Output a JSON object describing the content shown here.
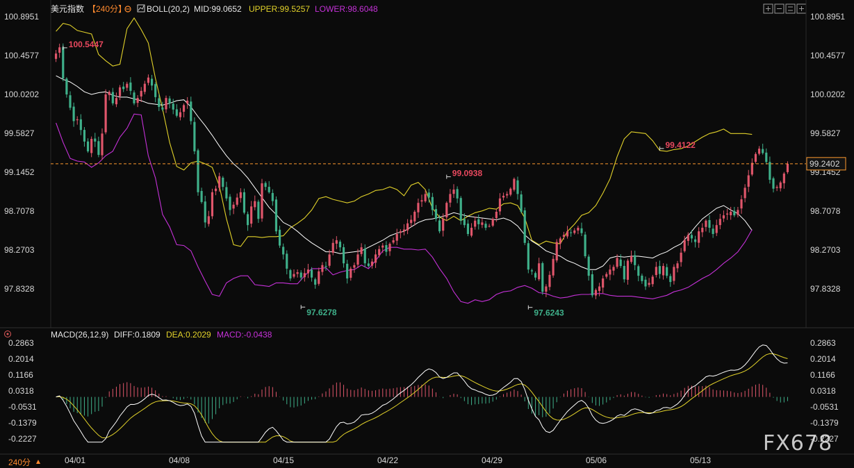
{
  "header": {
    "symbol": "美元指数",
    "period": "【240分】",
    "boll_label": "BOLL(20,2)",
    "mid_label": "MID:99.0652",
    "upper_label": "UPPER:99.5257",
    "lower_label": "LOWER:98.6048"
  },
  "macd_header": {
    "label": "MACD(26,12,9)",
    "diff_label": "DIFF:0.1809",
    "dea_label": "DEA:0.2029",
    "macd_label": "MACD:-0.0438"
  },
  "footer": {
    "period_button": "240分"
  },
  "watermark": "FX678",
  "colors": {
    "background": "#0b0b0b",
    "up": "#e0566b",
    "down": "#3fb08a",
    "boll_mid": "#ffffff",
    "boll_upper": "#e2d22a",
    "boll_lower": "#c531d8",
    "dea": "#e2d22a",
    "diff": "#ffffff",
    "current_price": "#ff9a2e",
    "high_label": "#e8485e",
    "low_label": "#3fb08a"
  },
  "icons": [
    "plus-icon",
    "minus-icon",
    "crosshair-icon",
    "layout-icon",
    "maximize-icon"
  ],
  "chart_data": [
    {
      "type": "candlestick",
      "title": "美元指数",
      "y_ticks": [
        "100.8951",
        "100.4577",
        "100.0202",
        "99.5827",
        "99.1452",
        "98.7078",
        "98.2703",
        "97.8328"
      ],
      "ylim": [
        97.75,
        100.9
      ],
      "x_ticks": [
        "04/01",
        "04/08",
        "04/15",
        "04/22",
        "04/29",
        "05/06",
        "05/13"
      ],
      "current_price": 99.2402,
      "current_price_label": "99.2402",
      "annotations": [
        {
          "label": "100.5447",
          "value": 100.5447,
          "kind": "high",
          "index": 2
        },
        {
          "label": "97.6278",
          "value": 97.6278,
          "kind": "low",
          "index": 69
        },
        {
          "label": "99.0938",
          "value": 99.0938,
          "kind": "high",
          "index": 110
        },
        {
          "label": "97.6243",
          "value": 97.6243,
          "kind": "low",
          "index": 133
        },
        {
          "label": "99.4122",
          "value": 99.4122,
          "kind": "high",
          "index": 170
        }
      ],
      "close": [
        100.48,
        100.55,
        100.2,
        100.02,
        99.87,
        99.72,
        99.74,
        99.62,
        99.49,
        99.38,
        99.52,
        99.49,
        99.34,
        99.58,
        100.02,
        100.05,
        99.92,
        99.98,
        100.1,
        100.08,
        100.14,
        100.06,
        99.92,
        99.98,
        100.06,
        100.14,
        100.21,
        100.12,
        99.99,
        99.88,
        99.85,
        99.98,
        99.92,
        99.85,
        99.78,
        99.82,
        99.9,
        99.95,
        99.72,
        99.38,
        98.92,
        98.81,
        98.58,
        98.65,
        98.92,
        98.96,
        99.1,
        98.98,
        98.85,
        98.72,
        98.78,
        98.86,
        98.92,
        98.69,
        98.55,
        98.76,
        98.82,
        98.62,
        99.02,
        98.98,
        98.92,
        98.82,
        98.48,
        98.32,
        98.22,
        98.06,
        97.95,
        98.0,
        98.02,
        97.96,
        98.01,
        98.05,
        97.96,
        97.88,
        98.03,
        98.1,
        98.08,
        98.22,
        98.35,
        98.38,
        98.3,
        98.12,
        97.95,
        98.06,
        98.1,
        98.22,
        98.3,
        98.12,
        98.09,
        98.14,
        98.22,
        98.28,
        98.32,
        98.25,
        98.34,
        98.38,
        98.45,
        98.48,
        98.5,
        98.57,
        98.61,
        98.7,
        98.8,
        98.83,
        98.9,
        98.86,
        98.72,
        98.62,
        98.48,
        98.62,
        98.8,
        98.9,
        98.95,
        98.85,
        98.6,
        98.55,
        98.45,
        98.52,
        98.6,
        98.56,
        98.58,
        98.52,
        98.54,
        98.62,
        98.7,
        98.85,
        98.88,
        98.9,
        98.96,
        99.07,
        98.9,
        98.7,
        98.35,
        98.05,
        98.03,
        97.96,
        98.12,
        97.8,
        97.86,
        97.99,
        98.17,
        98.36,
        98.4,
        98.44,
        98.48,
        98.46,
        98.49,
        98.52,
        98.46,
        98.2,
        97.98,
        97.76,
        97.82,
        97.86,
        97.95,
        98.0,
        98.05,
        98.08,
        98.18,
        98.09,
        97.94,
        98.15,
        98.2,
        98.1,
        97.98,
        97.92,
        97.86,
        97.9,
        97.97,
        98.08,
        98.0,
        98.09,
        97.98,
        97.91,
        98.08,
        98.12,
        98.24,
        98.38,
        98.44,
        98.4,
        98.36,
        98.48,
        98.52,
        98.6,
        98.52,
        98.45,
        98.55,
        98.62,
        98.66,
        98.68,
        98.7,
        98.66,
        98.72,
        98.84,
        98.97,
        99.11,
        99.25,
        99.35,
        99.41,
        99.36,
        99.26,
        99.06,
        98.96,
        98.98,
        99.03,
        99.13,
        99.24
      ],
      "boll_mid": [
        100.23,
        100.19,
        100.16,
        100.11,
        100.05,
        100.02,
        100.04,
        100.05,
        100.01,
        99.99,
        99.99,
        99.97,
        99.95,
        99.92,
        99.91,
        99.9,
        99.92,
        99.95,
        99.96,
        99.88,
        99.77,
        99.67,
        99.56,
        99.44,
        99.33,
        99.24,
        99.17,
        99.08,
        98.97,
        98.86,
        98.75,
        98.67,
        98.58,
        98.54,
        98.48,
        98.41,
        98.35,
        98.3,
        98.25,
        98.25,
        98.23,
        98.24,
        98.25,
        98.26,
        98.3,
        98.34,
        98.38,
        98.43,
        98.46,
        98.48,
        98.53,
        98.58,
        98.61,
        98.62,
        98.64,
        98.66,
        98.69,
        98.67,
        98.65,
        98.64,
        98.63,
        98.62,
        98.61,
        98.63,
        98.6,
        98.54,
        98.44,
        98.37,
        98.32,
        98.26,
        98.23,
        98.2,
        98.15,
        98.12,
        98.08,
        98.05,
        98.05,
        98.09,
        98.18,
        98.2,
        98.19,
        98.2,
        98.2,
        98.19,
        98.18,
        98.22,
        98.25,
        98.3,
        98.34,
        98.43,
        98.53,
        98.62,
        98.68,
        98.74,
        98.77,
        98.72,
        98.68,
        98.6,
        98.49
      ],
      "boll_upper": [
        100.73,
        100.82,
        100.8,
        100.74,
        100.72,
        100.7,
        100.47,
        100.4,
        100.34,
        100.36,
        100.76,
        100.88,
        100.75,
        100.6,
        100.2,
        99.86,
        99.48,
        99.21,
        99.17,
        99.25,
        99.27,
        99.24,
        99.2,
        98.99,
        98.62,
        98.33,
        98.31,
        98.42,
        98.42,
        98.41,
        98.42,
        98.42,
        98.43,
        98.52,
        98.57,
        98.63,
        98.72,
        98.85,
        98.87,
        98.84,
        98.82,
        98.8,
        98.82,
        98.87,
        98.9,
        98.94,
        98.95,
        98.98,
        98.95,
        98.88,
        99.0,
        99.03,
        98.95,
        98.74,
        98.64,
        98.6,
        98.65,
        98.6,
        98.65,
        98.69,
        98.71,
        98.74,
        98.73,
        98.79,
        98.8,
        98.77,
        98.63,
        98.38,
        98.33,
        98.37,
        98.35,
        98.34,
        98.48,
        98.56,
        98.66,
        98.69,
        98.77,
        98.91,
        99.07,
        99.32,
        99.52,
        99.6,
        99.59,
        99.58,
        99.5,
        99.39,
        99.38,
        99.4,
        99.41,
        99.44,
        99.49,
        99.54,
        99.58,
        99.6,
        99.63,
        99.58,
        99.58,
        99.58,
        99.57
      ],
      "boll_lower": [
        99.7,
        99.48,
        99.3,
        99.27,
        99.26,
        99.2,
        99.25,
        99.33,
        99.38,
        99.54,
        99.64,
        99.8,
        99.79,
        99.33,
        99.08,
        98.67,
        98.53,
        98.33,
        98.32,
        98.26,
        98.08,
        97.92,
        97.77,
        97.75,
        97.9,
        97.95,
        97.98,
        97.98,
        97.88,
        97.87,
        97.86,
        97.9,
        97.9,
        97.89,
        97.89,
        97.98,
        98.06,
        98.06,
        98.07,
        97.99,
        98.02,
        98.04,
        98.05,
        98.1,
        98.06,
        98.15,
        98.26,
        98.3,
        98.3,
        98.28,
        98.28,
        98.27,
        98.28,
        98.19,
        98.06,
        97.95,
        97.8,
        97.69,
        97.67,
        97.71,
        97.69,
        97.71,
        97.77,
        97.8,
        97.81,
        97.85,
        97.87,
        97.84,
        97.79,
        97.78,
        97.75,
        97.73,
        97.74,
        97.76,
        97.77,
        97.77,
        97.78,
        97.78,
        97.76,
        97.75,
        97.75,
        97.75,
        97.74,
        97.73,
        97.72,
        97.74,
        97.76,
        97.8,
        97.82,
        97.85,
        97.9,
        97.95,
        97.99,
        98.05,
        98.12,
        98.18,
        98.25,
        98.36,
        98.5
      ],
      "boll_step": 2
    },
    {
      "type": "macd",
      "title": "MACD(26,12,9)",
      "y_ticks": [
        "0.2863",
        "0.2014",
        "0.1166",
        "0.0318",
        "-0.0531",
        "-0.1379",
        "-0.2227"
      ],
      "ylim": [
        -0.24,
        0.3
      ],
      "diff_last": 0.1809,
      "dea_last": 0.2029,
      "macd_last": -0.0438
    }
  ]
}
